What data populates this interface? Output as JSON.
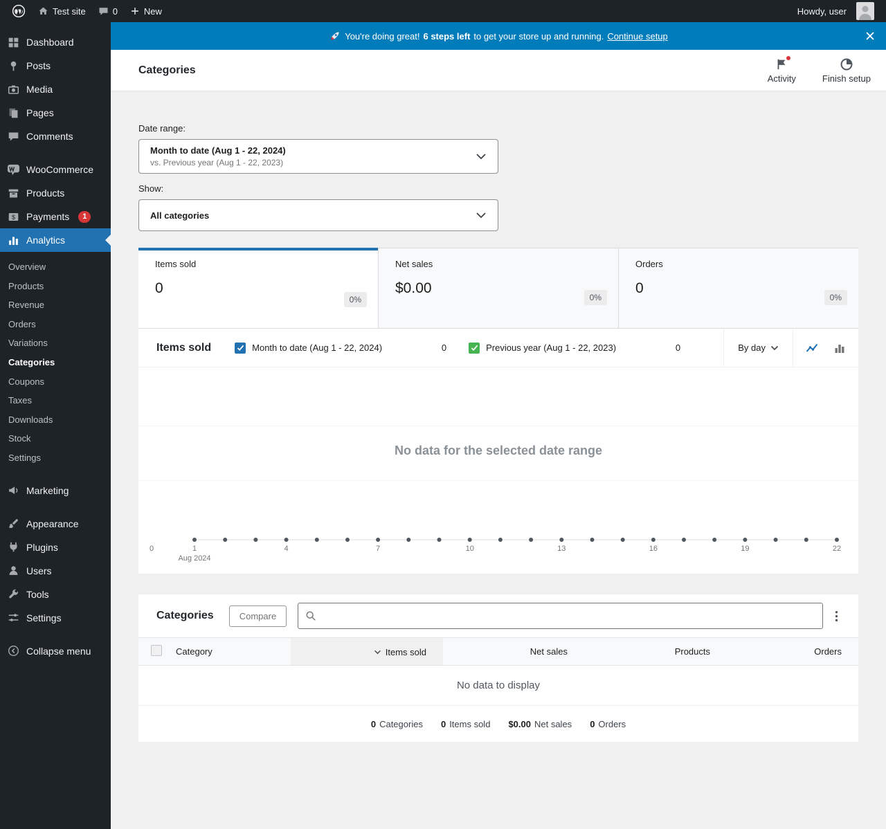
{
  "colors": {
    "accent": "#2271b1",
    "banner": "#007cba",
    "series_current": "#2271b1",
    "series_previous": "#46b450",
    "chart_dots": "#50575e",
    "badge_red": "#d63638"
  },
  "admin_bar": {
    "site_name": "Test site",
    "comments_count": "0",
    "new_label": "New",
    "howdy": "Howdy, user"
  },
  "sidebar": {
    "items": [
      "Dashboard",
      "Posts",
      "Media",
      "Pages",
      "Comments",
      "WooCommerce",
      "Products",
      "Payments",
      "Analytics",
      "Marketing",
      "Appearance",
      "Plugins",
      "Users",
      "Tools",
      "Settings",
      "Collapse menu"
    ],
    "payments_badge": "1",
    "analytics_submenu": [
      "Overview",
      "Products",
      "Revenue",
      "Orders",
      "Variations",
      "Categories",
      "Coupons",
      "Taxes",
      "Downloads",
      "Stock",
      "Settings"
    ],
    "active_item": "Analytics",
    "active_submenu_item": "Categories"
  },
  "banner": {
    "emoji": "🚀",
    "message_prefix": "You're doing great!",
    "steps_left": "6 steps left",
    "message_suffix": "to get your store up and running.",
    "link_label": "Continue setup"
  },
  "header": {
    "title": "Categories",
    "activity_label": "Activity",
    "finish_setup_label": "Finish setup"
  },
  "filters": {
    "date_range_label": "Date range:",
    "date_range_value": "Month to date (Aug 1 - 22, 2024)",
    "date_range_compare": "vs. Previous year (Aug 1 - 22, 2023)",
    "show_label": "Show:",
    "show_value": "All categories"
  },
  "summary_stats": [
    {
      "label": "Items sold",
      "value": "0",
      "delta": "0%",
      "selected": true
    },
    {
      "label": "Net sales",
      "value": "$0.00",
      "delta": "0%",
      "selected": false
    },
    {
      "label": "Orders",
      "value": "0",
      "delta": "0%",
      "selected": false
    }
  ],
  "chart": {
    "title": "Items sold",
    "legend": [
      {
        "label": "Month to date (Aug 1 - 22, 2024)",
        "value": "0",
        "checked": true
      },
      {
        "label": "Previous year (Aug 1 - 22, 2023)",
        "value": "0",
        "checked": true
      }
    ],
    "interval": "By day",
    "empty_message": "No data for the selected date range",
    "y_axis_zero": "0",
    "x_ticks": [
      "1",
      "4",
      "7",
      "10",
      "13",
      "16",
      "19",
      "22"
    ],
    "x_axis_month": "Aug 2024",
    "days": 22
  },
  "table": {
    "title": "Categories",
    "compare_label": "Compare",
    "search_value": "",
    "columns": [
      "Category",
      "Items sold",
      "Net sales",
      "Products",
      "Orders"
    ],
    "sorted_column": "Items sold",
    "empty_message": "No data to display",
    "summary": [
      {
        "value": "0",
        "label": "Categories"
      },
      {
        "value": "0",
        "label": "Items sold"
      },
      {
        "value": "$0.00",
        "label": "Net sales"
      },
      {
        "value": "0",
        "label": "Orders"
      }
    ]
  },
  "icons": {
    "close": "✕",
    "kebab": "⋮",
    "search": "⌕",
    "chevron_down": "⌄"
  }
}
